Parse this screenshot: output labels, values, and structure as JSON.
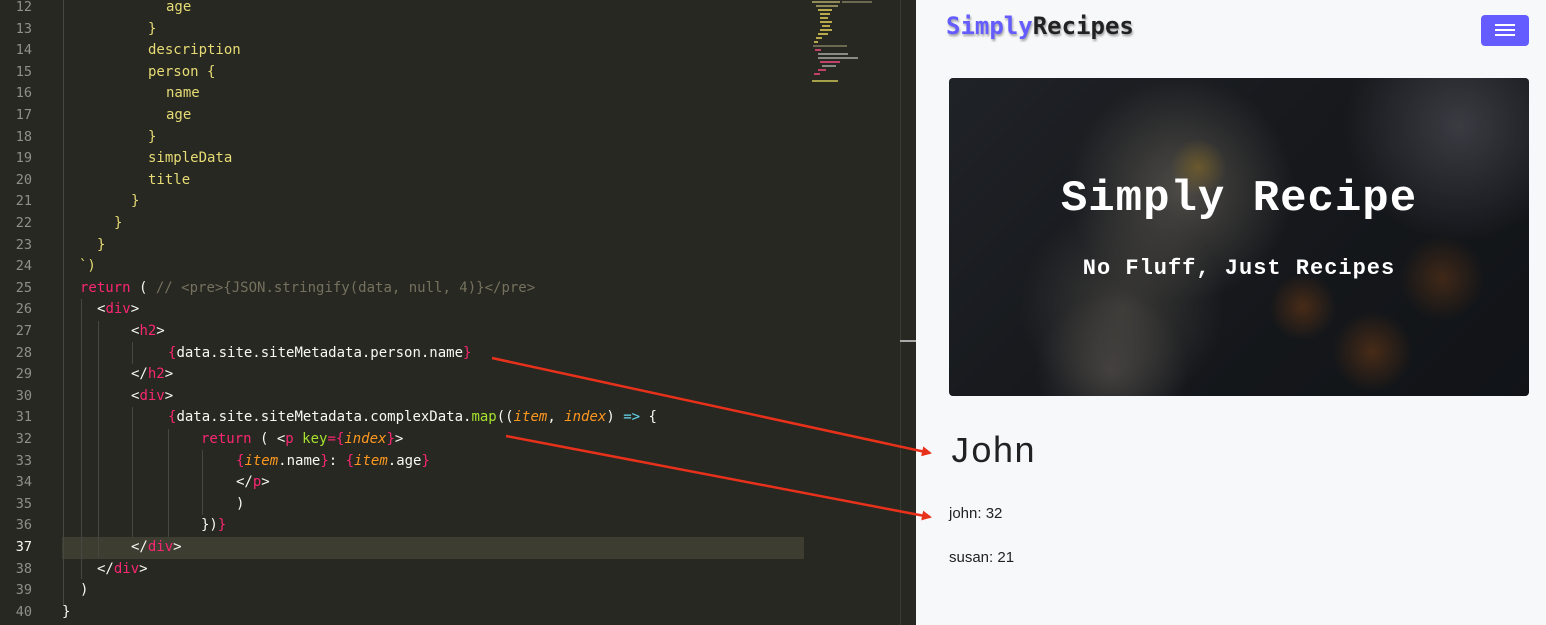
{
  "editor": {
    "current_line": "37",
    "line_numbers": [
      "12",
      "13",
      "14",
      "15",
      "16",
      "17",
      "18",
      "19",
      "20",
      "21",
      "22",
      "23",
      "24",
      "25",
      "26",
      "27",
      "28",
      "29",
      "30",
      "31",
      "32",
      "33",
      "34",
      "35",
      "36",
      "37",
      "38",
      "39",
      "40"
    ],
    "code": {
      "l12": "age",
      "l13": "}",
      "l14": "description",
      "l15": "person {",
      "l16": "name",
      "l17": "age",
      "l18": "}",
      "l19": "simpleData",
      "l20": "title",
      "l21": "}",
      "l22": "}",
      "l23": "}",
      "l24": "`)",
      "l25_kw": "return",
      "l25_paren": " ( ",
      "l25_comment": "// <pre>{JSON.stringify(data, null, 4)}</pre>",
      "l26_open": "<",
      "l26_tag": "div",
      "l26_close": ">",
      "l27_open": "<",
      "l27_tag": "h2",
      "l27_close": ">",
      "l28_lb": "{",
      "l28_expr": "data.site.siteMetadata.person.name",
      "l28_rb": "}",
      "l29_open": "</",
      "l29_tag": "h2",
      "l29_close": ">",
      "l30_open": "<",
      "l30_tag": "div",
      "l30_close": ">",
      "l31_lb": "{",
      "l31_expr": "data.site.siteMetadata.complexData.",
      "l31_fn": "map",
      "l31_p1": "((",
      "l31_item": "item",
      "l31_comma": ", ",
      "l31_index": "index",
      "l31_p2": ") ",
      "l31_arrow": "=>",
      "l31_brace": " {",
      "l32_ret": "return ( <",
      "l32_tag": "p",
      "l32_sp": " ",
      "l32_attr": "key",
      "l32_eq": "={",
      "l32_index": "index",
      "l32_rb": "}",
      "l32_gt": ">",
      "l33_lb1": "{",
      "l33_item1": "item",
      "l33_name": ".name",
      "l33_rb1": "}",
      "l33_colon": ": ",
      "l33_lb2": "{",
      "l33_item2": "item",
      "l33_age": ".age",
      "l33_rb2": "}",
      "l34_open": "</",
      "l34_tag": "p",
      "l34_close": ">",
      "l35": ")",
      "l36_a": "})",
      "l36_b": "}",
      "l37_open": "</",
      "l37_tag": "div",
      "l37_close": ">",
      "l38_open": "</",
      "l38_tag": "div",
      "l38_close": ">",
      "l39": ")",
      "l40": "}"
    }
  },
  "browser": {
    "brand_primary": "Simply",
    "brand_secondary": "Recipes",
    "menu_icon": "hamburger-menu-icon",
    "hero_title": "Simply Recipe",
    "hero_subtitle": "No Fluff, Just Recipes",
    "person_name": "John",
    "items": [
      "john: 32",
      "susan: 21"
    ]
  },
  "colors": {
    "editor_bg": "#272822",
    "keyword": "#f92672",
    "string_yellow": "#e6db74",
    "comment": "#75715e",
    "function": "#a6e22e",
    "param": "#fd971f",
    "brand_accent": "#645cff",
    "arrow_red": "#e8311a"
  }
}
